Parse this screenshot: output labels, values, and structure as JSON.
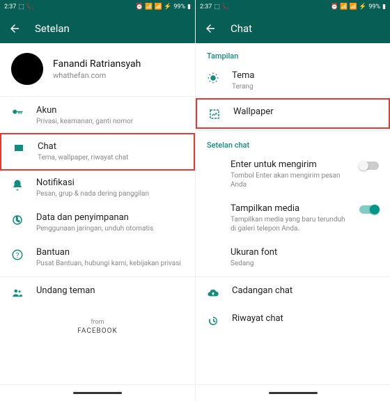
{
  "statusbar": {
    "time": "2:37",
    "battery": "99%"
  },
  "left": {
    "title": "Setelan",
    "profile": {
      "name": "Fanandi Ratriansyah",
      "sub": "whathefan.com"
    },
    "items": [
      {
        "title": "Akun",
        "subtitle": "Privasi, keamanan, ganti nomor"
      },
      {
        "title": "Chat",
        "subtitle": "Tema, wallpaper, riwayat chat"
      },
      {
        "title": "Notifikasi",
        "subtitle": "Pesan, grup & nada dering panggilan"
      },
      {
        "title": "Data dan penyimpanan",
        "subtitle": "Penggunaan jaringan, unduh otomatis"
      },
      {
        "title": "Bantuan",
        "subtitle": "Pusat Bantuan, hubungi kami, kebijakan privasi"
      },
      {
        "title": "Undang teman",
        "subtitle": ""
      }
    ],
    "footer": {
      "from": "from",
      "brand": "FACEBOOK"
    }
  },
  "right": {
    "title": "Chat",
    "section_tampilan": "Tampilan",
    "tema": {
      "title": "Tema",
      "subtitle": "Terang"
    },
    "wallpaper": {
      "title": "Wallpaper"
    },
    "section_setelan": "Setelan chat",
    "enter": {
      "title": "Enter untuk mengirim",
      "subtitle": "Tombol Enter akan mengirim pesan Anda"
    },
    "media": {
      "title": "Tampilkan media",
      "subtitle": "Tampilkan media yang baru terunduh di galeri telepon Anda."
    },
    "font": {
      "title": "Ukuran font",
      "subtitle": "Sedang"
    },
    "cadangan": {
      "title": "Cadangan chat"
    },
    "riwayat": {
      "title": "Riwayat chat"
    }
  }
}
